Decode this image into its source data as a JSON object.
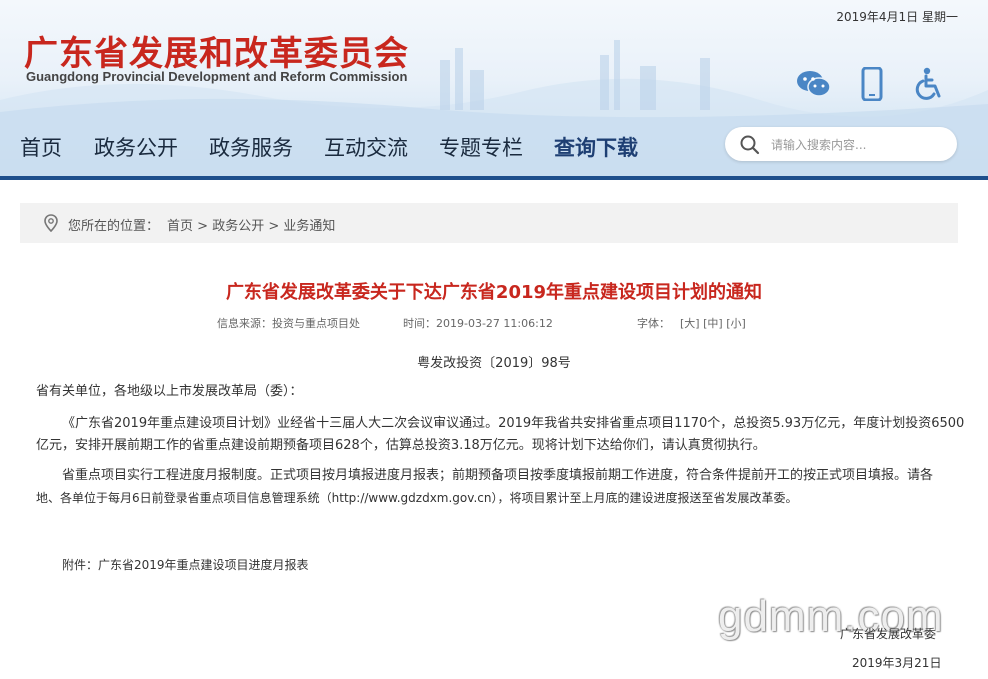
{
  "header": {
    "date": "2019年4月1日  星期一",
    "logo_cn": "广东省发展和改革委员会",
    "logo_en": "Guangdong Provincial Development and Reform Commission",
    "tools": [
      {
        "icon": "wechat-icon"
      },
      {
        "icon": "mobile-icon"
      },
      {
        "icon": "accessibility-icon"
      }
    ]
  },
  "nav": {
    "items": [
      "首页",
      "政务公开",
      "政务服务",
      "互动交流",
      "专题专栏",
      "查询下载"
    ],
    "active": "查询下载"
  },
  "search": {
    "placeholder": "请输入搜索内容..."
  },
  "breadcrumb": {
    "prefix": "您所在的位置：",
    "items": [
      "首页",
      "政务公开",
      "业务通知"
    ],
    "separator": " > "
  },
  "article": {
    "title": "广东省发展改革委关于下达广东省2019年重点建设项目计划的通知",
    "source_label": "信息来源：",
    "source": "投资与重点项目处",
    "time_label": "时间：",
    "time": "2019-03-27 11:06:12",
    "font_label": "字体：",
    "font_sizes": [
      "[大]",
      "[中]",
      "[小]"
    ],
    "doc_no": "粤发改投资〔2019〕98号",
    "salutation": "省有关单位，各地级以上市发展改革局（委）：",
    "para1_line1": "《广东省2019年重点建设项目计划》业经省十三届人大二次会议审议通过。2019年我省共安排省重点项目1170个，总投资5.93万亿元，年度计划投资6500",
    "para1_line2": "亿元，安排开展前期工作的省重点建设前期预备项目628个，估算总投资3.18万亿元。现将计划下达给你们，请认真贯彻执行。",
    "para2_line1": "省重点项目实行工程进度月报制度。正式项目按月填报进度月报表；前期预备项目按季度填报前期工作进度，符合条件提前开工的按正式项目填报。请各",
    "para2_line2": "地、各单位于每月6日前登录省重点项目信息管理系统（http://www.gdzdxm.gov.cn），将项目累计至上月底的建设进度报送至省发展改革委。",
    "attachment": "附件：广东省2019年重点建设项目进度月报表",
    "signer": "广东省发展改革委",
    "sign_date": "2019年3月21日"
  },
  "watermark": "gdmm.com",
  "colors": {
    "brand_red": "#c8271e",
    "nav_blue": "#1e4f8c"
  }
}
